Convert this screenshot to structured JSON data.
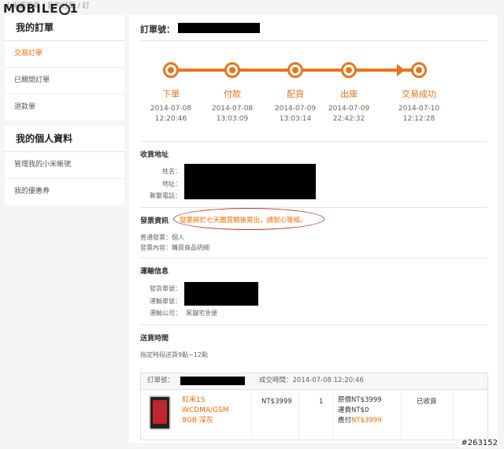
{
  "topbar": {
    "breadcrumb": "小米網首頁 / 我的訂單 / 訂",
    "logo_prefix": "MOBILE",
    "logo_suffix": "1"
  },
  "sidebar": {
    "section1": {
      "title": "我的訂單",
      "items": [
        {
          "label": "交易訂單",
          "active": true
        },
        {
          "label": "已關閉訂單",
          "active": false
        },
        {
          "label": "退款單",
          "active": false
        }
      ]
    },
    "section2": {
      "title": "我的個人資料",
      "items": [
        {
          "label": "管理我的小米帳號"
        },
        {
          "label": "我的優惠券"
        }
      ]
    }
  },
  "order": {
    "number_label": "訂單號："
  },
  "progress": {
    "accent": "#e8751a",
    "steps": [
      {
        "label": "下單",
        "date": "2014-07-08",
        "time": "12:20:46"
      },
      {
        "label": "付款",
        "date": "2014-07-08",
        "time": "13:03:09"
      },
      {
        "label": "配貨",
        "date": "2014-07-09",
        "time": "13:03:14"
      },
      {
        "label": "出庫",
        "date": "2014-07-09",
        "time": "22:42:32"
      },
      {
        "label": "交易成功",
        "date": "2014-07-10",
        "time": "12:12:28"
      }
    ]
  },
  "shipping_address": {
    "title": "收貨地址",
    "name_label": "姓名：",
    "address_label": "地址：",
    "phone_label": "聯繫電話："
  },
  "invoice": {
    "title": "發票資訊",
    "note": "發票將於七天鑑賞期後寄出，請耐心等候。",
    "type": "普通發票：個人",
    "content": "發票內容：購買商品明細"
  },
  "transport": {
    "title": "運輸信息",
    "shipment_no_label": "發貨單號：",
    "tracking_no_label": "運輸單號：",
    "company_label": "運輸公司：",
    "company_value": "黑貓宅急便"
  },
  "delivery_time": {
    "title": "送貨時間",
    "value": "指定時段送貨9點~12點"
  },
  "item_box": {
    "order_no_label": "訂單號：",
    "deal_time": "成交時間：2014-07-08 12:20:46",
    "product": {
      "name_line1": "紅米1S",
      "name_line2": "WCDMA/GSM",
      "name_line3": "8GB 深灰"
    },
    "unit_price": "NT$3999",
    "quantity": "1",
    "original_price": "原價NT$3999",
    "shipping_fee": "運費NT$0",
    "paid_label": "應付",
    "paid_value": "NT$3999",
    "status": "已收貨"
  },
  "watermark": "#263152"
}
